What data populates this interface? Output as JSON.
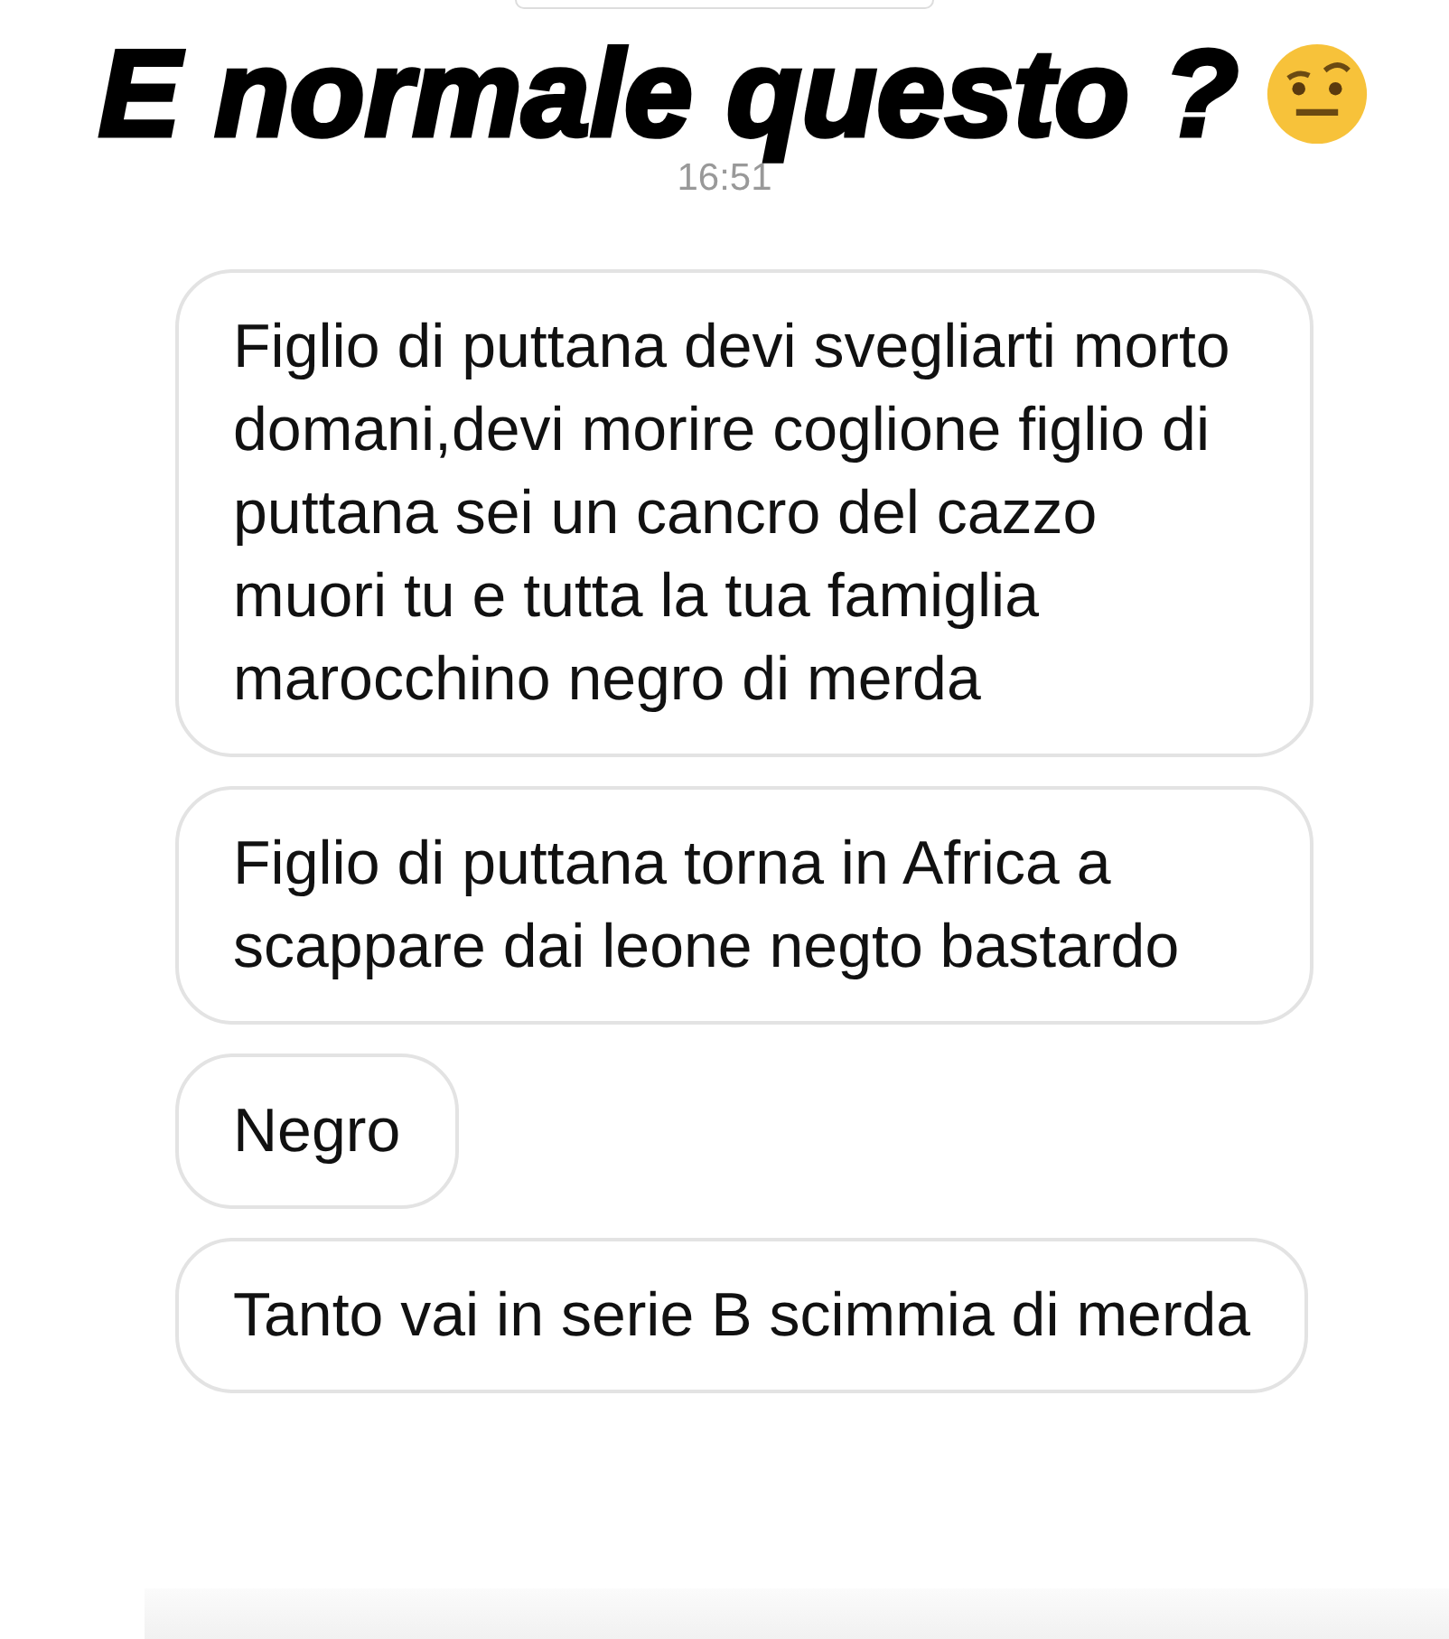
{
  "title": "E normale questo ?",
  "time": "16:51",
  "messages": [
    {
      "text": "Figlio di puttana devi svegliarti morto domani,devi morire coglione figlio di puttana sei un cancro del cazzo muori tu e tutta la tua famiglia marocchino negro di merda"
    },
    {
      "text": "Figlio di puttana torna in Africa a scappare dai leone negto bastardo"
    },
    {
      "text": "Negro"
    },
    {
      "text": "Tanto vai in serie B scimmia di merda"
    }
  ]
}
